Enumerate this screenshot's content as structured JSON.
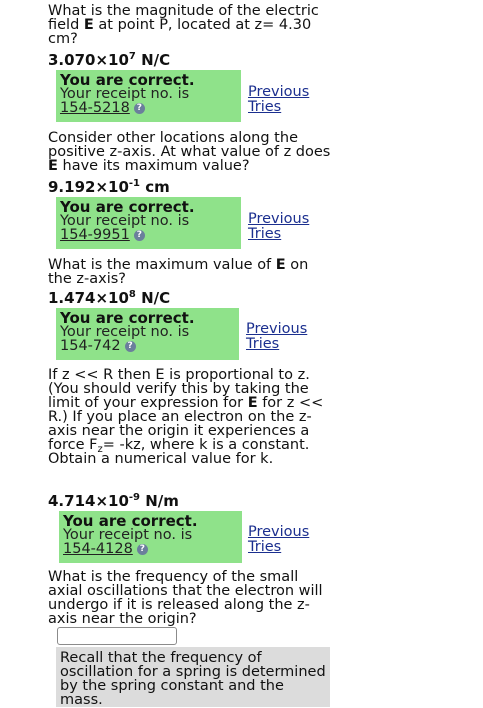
{
  "q1": {
    "prefix": "What is the magnitude of the electric field ",
    "bold": "E",
    "suffix": " at point P, located at z= 4.30 cm?",
    "answer_base": "3.070×10",
    "answer_exp": "7",
    "answer_unit": " N/C"
  },
  "q2": {
    "text1": "Consider other locations along the positive z-axis. At what value of z does ",
    "bold": "E",
    "text2": " have its maximum value?",
    "answer_base": "9.192×10",
    "answer_exp": "-1",
    "answer_unit": " cm"
  },
  "q3": {
    "text1": "What is the maximum value of ",
    "bold": "E",
    "text2": " on the z-axis?",
    "answer_base": "1.474×10",
    "answer_exp": "8",
    "answer_unit": " N/C"
  },
  "q4": {
    "t1": "If z << R then E is proportional to z. (You should verify this by taking the limit of your expression for ",
    "b1": "E",
    "t2": " for z << R.) If you place an electron on the z-axis near the origin it experiences a force F",
    "sub": "z",
    "t3": "= -kz, where k is a constant. Obtain a numerical value for k.",
    "answer_base": "4.714×10",
    "answer_exp": "-9",
    "answer_unit": " N/m"
  },
  "q5": {
    "text": "What is the frequency of the small axial oscillations that the electron will undergo if it is released along the z-axis near the origin?"
  },
  "feedback": {
    "correct": "You are correct.",
    "receipt_label": "Your receipt no. is",
    "receipts": [
      "154-5218",
      "154-9951",
      "154-742",
      "154-4128"
    ],
    "previous_tries": "Previous Tries",
    "info_icon_char": "?"
  },
  "hint": {
    "text": "Recall that the frequency of oscillation for a spring is determined by the spring constant and the mass."
  },
  "colors": {
    "correct_bg": "#8fe28a",
    "link": "#1b2f8f",
    "hint_bg": "#dcdcdc"
  }
}
